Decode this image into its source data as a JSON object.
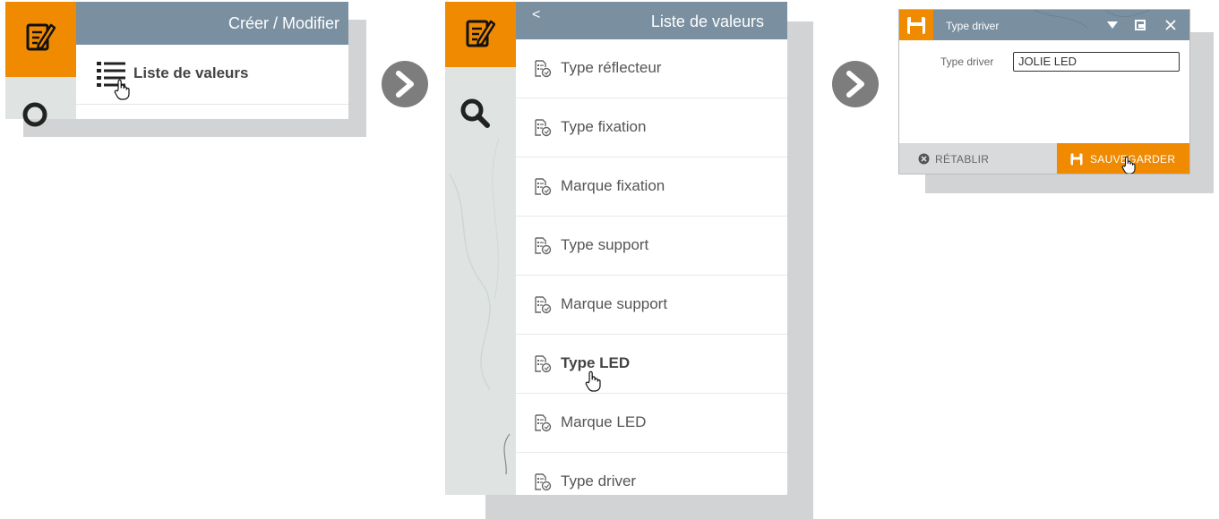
{
  "panel1": {
    "header_title": "Créer / Modifier",
    "item_label": "Liste de valeurs",
    "icons": [
      "edit-form-icon",
      "search-icon",
      "list-icon",
      "hand-cursor-icon"
    ]
  },
  "panel2": {
    "back_glyph": "<",
    "header_title": "Liste de valeurs",
    "items": [
      {
        "label": "Type réflecteur"
      },
      {
        "label": "Type fixation"
      },
      {
        "label": "Marque fixation"
      },
      {
        "label": "Type support"
      },
      {
        "label": "Marque support"
      },
      {
        "label": "Type LED"
      },
      {
        "label": "Marque LED"
      },
      {
        "label": "Type driver"
      }
    ],
    "icons": [
      "edit-form-icon",
      "search-icon",
      "value-list-item-icon",
      "hand-cursor-icon"
    ]
  },
  "panel3": {
    "window_title": "Type driver",
    "field_label": "Type driver",
    "field_value": "JOLIE LED",
    "reset_label": "RÉTABLIR",
    "save_label": "SAUVEGARDER",
    "icons": [
      "save-icon",
      "caret-down-icon",
      "restore-window-icon",
      "close-icon",
      "reset-icon",
      "hand-cursor-icon"
    ]
  },
  "colors": {
    "accent": "#f08a00",
    "header": "#7a8fa0",
    "arrow": "#7d7d7d",
    "shadow": "#d2d3d5"
  }
}
